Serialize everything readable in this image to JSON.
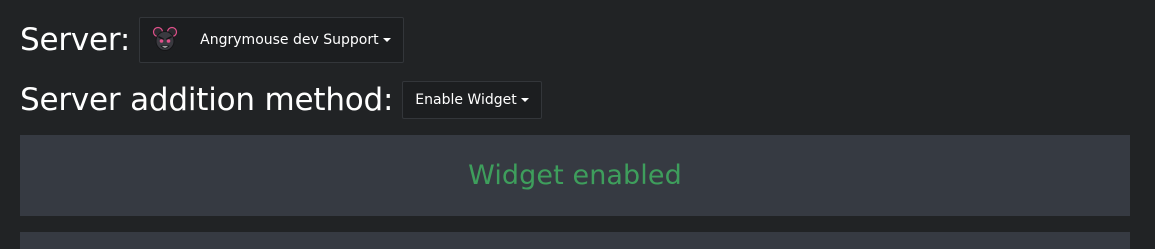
{
  "server": {
    "label": "Server:",
    "selected": "Angrymouse dev Support",
    "avatar_icon": "angry-mouse-avatar-icon"
  },
  "method": {
    "label": "Server addition method:",
    "selected": "Enable Widget"
  },
  "status": {
    "text": "Widget enabled",
    "color": "#3e9e5c"
  },
  "colors": {
    "background": "#212325",
    "panel": "#363a42",
    "dropdown_bg": "#1c1e20",
    "avatar_accent": "#e0508a"
  }
}
